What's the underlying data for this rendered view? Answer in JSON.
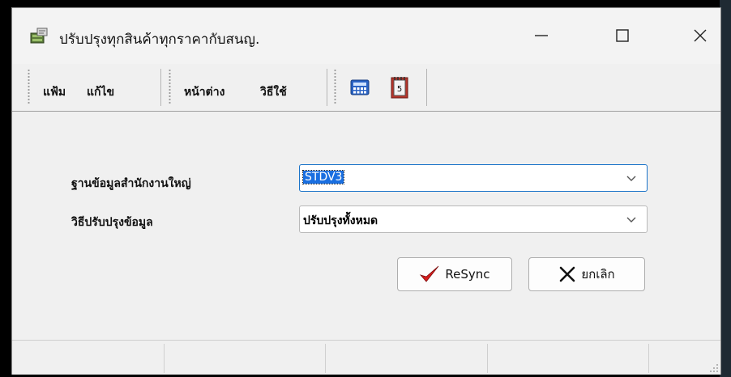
{
  "window": {
    "title": "ปรับปรุงทุกสินค้าทุกราคากับสนญ."
  },
  "toolbar": {
    "menu": [
      "แฟ้ม",
      "แก้ไข",
      "หน้าต่าง",
      "วิธีใช้"
    ],
    "icons": [
      "calculator-icon",
      "calendar-icon"
    ],
    "calendar_digit": "5"
  },
  "form": {
    "head_office_db": {
      "label": "ฐานข้อมูลสำนักงานใหญ่",
      "value": "STDV3"
    },
    "update_method": {
      "label": "วิธีปรับปรุงข้อมูล",
      "value": "ปรับปรุงทั้งหมด"
    }
  },
  "buttons": {
    "resync": "ReSync",
    "cancel": "ยกเลิก"
  },
  "colors": {
    "accent": "#1a6fe0",
    "check": "#d71d1d"
  }
}
